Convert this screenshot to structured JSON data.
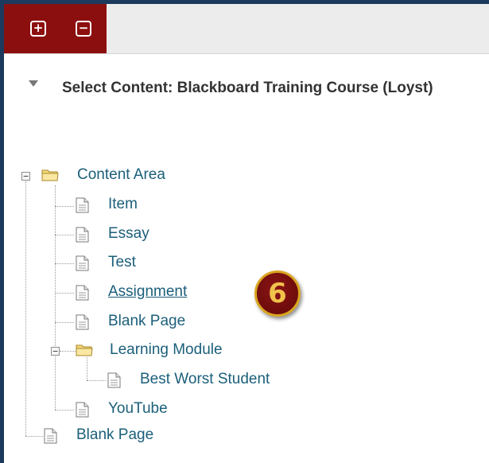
{
  "toolbar": {
    "expand_all_glyph": "+",
    "collapse_all_glyph": "−"
  },
  "heading": {
    "title": "Select Content: Blackboard Training Course (Loyst)"
  },
  "tree": {
    "root": {
      "label": "Content Area",
      "children": [
        {
          "label": "Item"
        },
        {
          "label": "Essay"
        },
        {
          "label": "Test"
        },
        {
          "label": "Assignment"
        },
        {
          "label": "Blank Page"
        },
        {
          "label": "Learning Module",
          "children": [
            {
              "label": "Best Worst Student"
            }
          ]
        },
        {
          "label": "YouTube"
        }
      ]
    },
    "sibling": {
      "label": "Blank Page"
    },
    "pm_minus": "−"
  },
  "badge": {
    "number": "6"
  },
  "colors": {
    "frame": "#1c3a5e",
    "toolbar_accent": "#8c0f0f",
    "link": "#1b5f7a",
    "badge_gold": "#d9a520"
  }
}
